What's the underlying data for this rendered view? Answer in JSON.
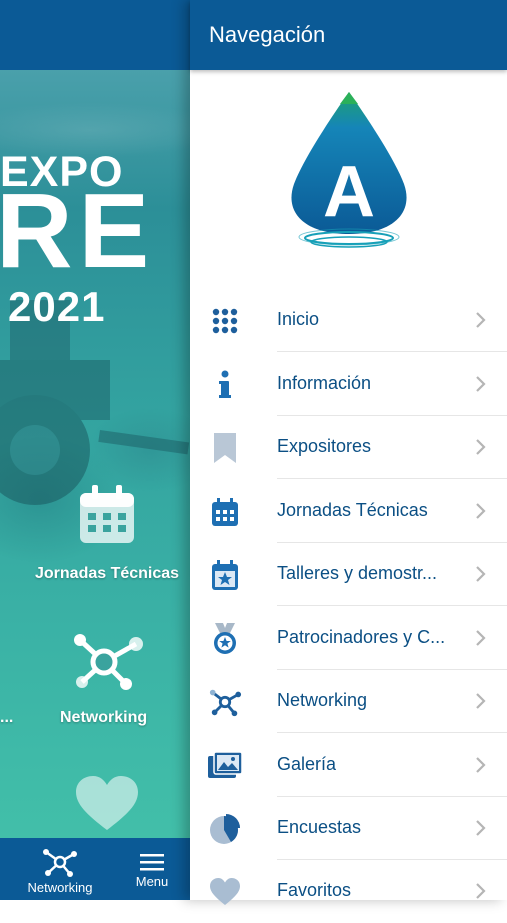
{
  "background_app": {
    "hero": {
      "line1": "EXPO",
      "line2": "RE",
      "year": "2021"
    },
    "tiles": [
      {
        "label": "Jornadas Técnicas",
        "icon": "calendar-icon"
      },
      {
        "label": "Networking",
        "icon": "network-icon"
      },
      {
        "label": "...",
        "icon": ""
      },
      {
        "label": "",
        "icon": "heart-icon"
      }
    ],
    "tabbar": [
      {
        "label": "Networking",
        "icon": "network-icon"
      },
      {
        "label": "Menu",
        "icon": "hamburger-icon"
      }
    ]
  },
  "drawer": {
    "title": "Navegación",
    "logo_letter": "A",
    "items": [
      {
        "label": "Inicio",
        "icon": "grid-icon"
      },
      {
        "label": "Información",
        "icon": "info-icon"
      },
      {
        "label": "Expositores",
        "icon": "bookmark-icon"
      },
      {
        "label": "Jornadas Técnicas",
        "icon": "calendar-icon"
      },
      {
        "label": "Talleres y demostr...",
        "icon": "calendar-star-icon"
      },
      {
        "label": "Patrocinadores y C...",
        "icon": "medal-icon"
      },
      {
        "label": "Networking",
        "icon": "network-icon"
      },
      {
        "label": "Galería",
        "icon": "gallery-icon"
      },
      {
        "label": "Encuestas",
        "icon": "pie-chart-icon"
      },
      {
        "label": "Favoritos",
        "icon": "heart-icon"
      }
    ]
  },
  "colors": {
    "primary": "#0b5a96",
    "text": "#0b4f84",
    "icon": "#1e6fb3",
    "chevron": "#b5b5b5",
    "teal": "#3bb3a6"
  }
}
